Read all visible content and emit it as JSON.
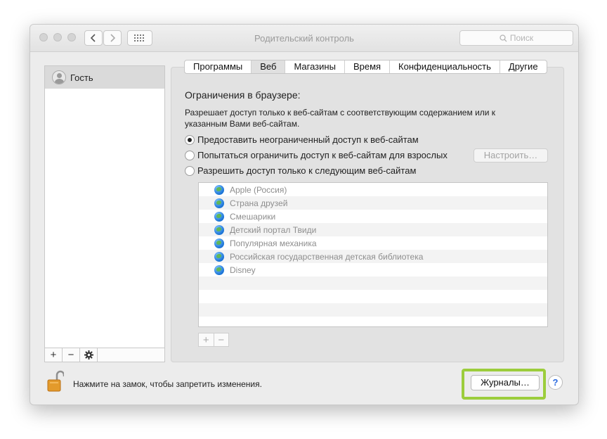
{
  "window": {
    "title": "Родительский контроль"
  },
  "toolbar": {
    "back_icon": "chevron-left",
    "forward_icon": "chevron-right",
    "grid_icon": "show-all-grid",
    "search_placeholder": "Поиск"
  },
  "sidebar": {
    "users": [
      {
        "label": "Гость",
        "selected": true
      }
    ],
    "add_label": "+",
    "remove_label": "−",
    "gear_icon": "gear"
  },
  "tabs": [
    {
      "label": "Программы",
      "active": false
    },
    {
      "label": "Веб",
      "active": true
    },
    {
      "label": "Магазины",
      "active": false
    },
    {
      "label": "Время",
      "active": false
    },
    {
      "label": "Конфиденциальность",
      "active": false
    },
    {
      "label": "Другие",
      "active": false
    }
  ],
  "web": {
    "heading": "Ограничения в браузере:",
    "description": "Разрешает доступ только к веб-сайтам с соответствующим содержанием или к указанным Вами веб-сайтам.",
    "options": [
      {
        "label": "Предоставить неограниченный доступ к веб-сайтам",
        "selected": true
      },
      {
        "label": "Попытаться ограничить доступ к веб-сайтам для взрослых",
        "selected": false
      },
      {
        "label": "Разрешить доступ только к следующим веб-сайтам",
        "selected": false
      }
    ],
    "configure_label": "Настроить…",
    "sites": [
      "Apple (Россия)",
      "Страна друзей",
      "Смешарики",
      "Детский портал Твиди",
      "Популярная механика",
      "Российская государственная детская библиотека",
      "Disney"
    ],
    "add_site_label": "+",
    "remove_site_label": "−"
  },
  "footer": {
    "lock_text": "Нажмите на замок, чтобы запретить изменения.",
    "logs_label": "Журналы…",
    "help_label": "?"
  },
  "colors": {
    "highlight": "#9ccd3c",
    "window_bg": "#ececec",
    "help_accent": "#2a6ae0"
  }
}
